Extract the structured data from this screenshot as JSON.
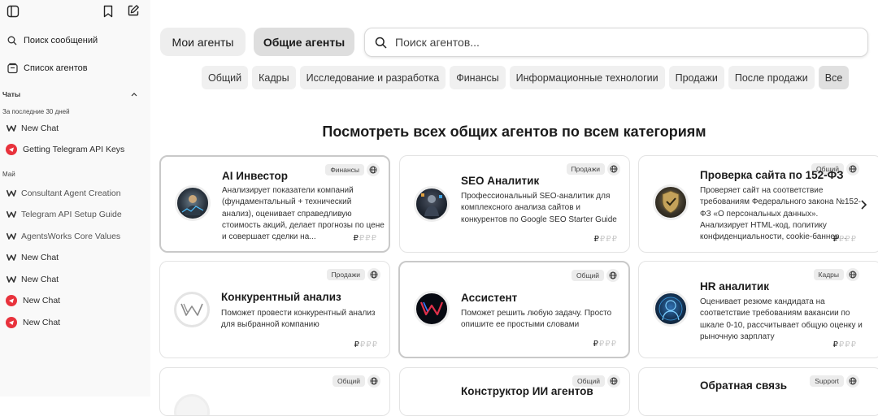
{
  "sidebar": {
    "search_label": "Поиск сообщений",
    "agents_list_label": "Список агентов",
    "chats_section": "Чаты",
    "groups": [
      {
        "label": "За последние 30 дней",
        "chats": [
          "New Chat",
          "Getting Telegram API Keys"
        ]
      },
      {
        "label": "Май",
        "chats": [
          "Consultant Agent Creation",
          "Telegram API Setup Guide",
          "AgentsWorks Core Values",
          "New Chat",
          "New Chat",
          "New Chat",
          "New Chat"
        ]
      }
    ]
  },
  "tabs": {
    "my": "Мои агенты",
    "shared": "Общие агенты"
  },
  "search": {
    "placeholder": "Поиск агентов..."
  },
  "categories": [
    "Общий",
    "Кадры",
    "Исследование и разработка",
    "Финансы",
    "Информационные технологии",
    "Продажи",
    "После продажи",
    "Все"
  ],
  "heading": "Посмотреть всех общих агентов по всем категориям",
  "price_symbol": "₽",
  "cards": [
    {
      "title": "AI Инвестор",
      "badge": "Финансы",
      "desc": "Анализирует показатели компаний (фундаментальный + технический анализ), оценивает справедливую стоимость акций, делает прогнозы по цене и совершает сделки на..."
    },
    {
      "title": "SEO Аналитик",
      "badge": "Продажи",
      "desc": "Профессиональный SEO-аналитик для комплексного анализа сайтов и конкурентов по Google SEO Starter Guide"
    },
    {
      "title": "Проверка сайта по 152-ФЗ",
      "badge": "Общий",
      "desc": "Проверяет сайт на соответствие требованиям Федерального закона №152-ФЗ «О персональных данных». Анализирует HTML-код, политику конфиденциальности, cookie-баннер..."
    },
    {
      "title": "Конкурентный анализ",
      "badge": "Продажи",
      "desc": "Поможет провести конкурентный анализ для выбранной компанию"
    },
    {
      "title": "Ассистент",
      "badge": "Общий",
      "desc": "Поможет решить любую задачу. Просто опишите ее простыми словами"
    },
    {
      "title": "HR аналитик",
      "badge": "Кадры",
      "desc": "Оценивает резюме кандидата на соответствие требованиям вакансии по шкале 0-10, рассчитывает общую оценку и рыночную зарплату"
    },
    {
      "title": "",
      "badge": "Общий",
      "desc": ""
    },
    {
      "title": "Конструктор ИИ агентов",
      "badge": "Общий",
      "desc": ""
    },
    {
      "title": "Обратная связь",
      "badge": "Support",
      "desc": ""
    }
  ]
}
